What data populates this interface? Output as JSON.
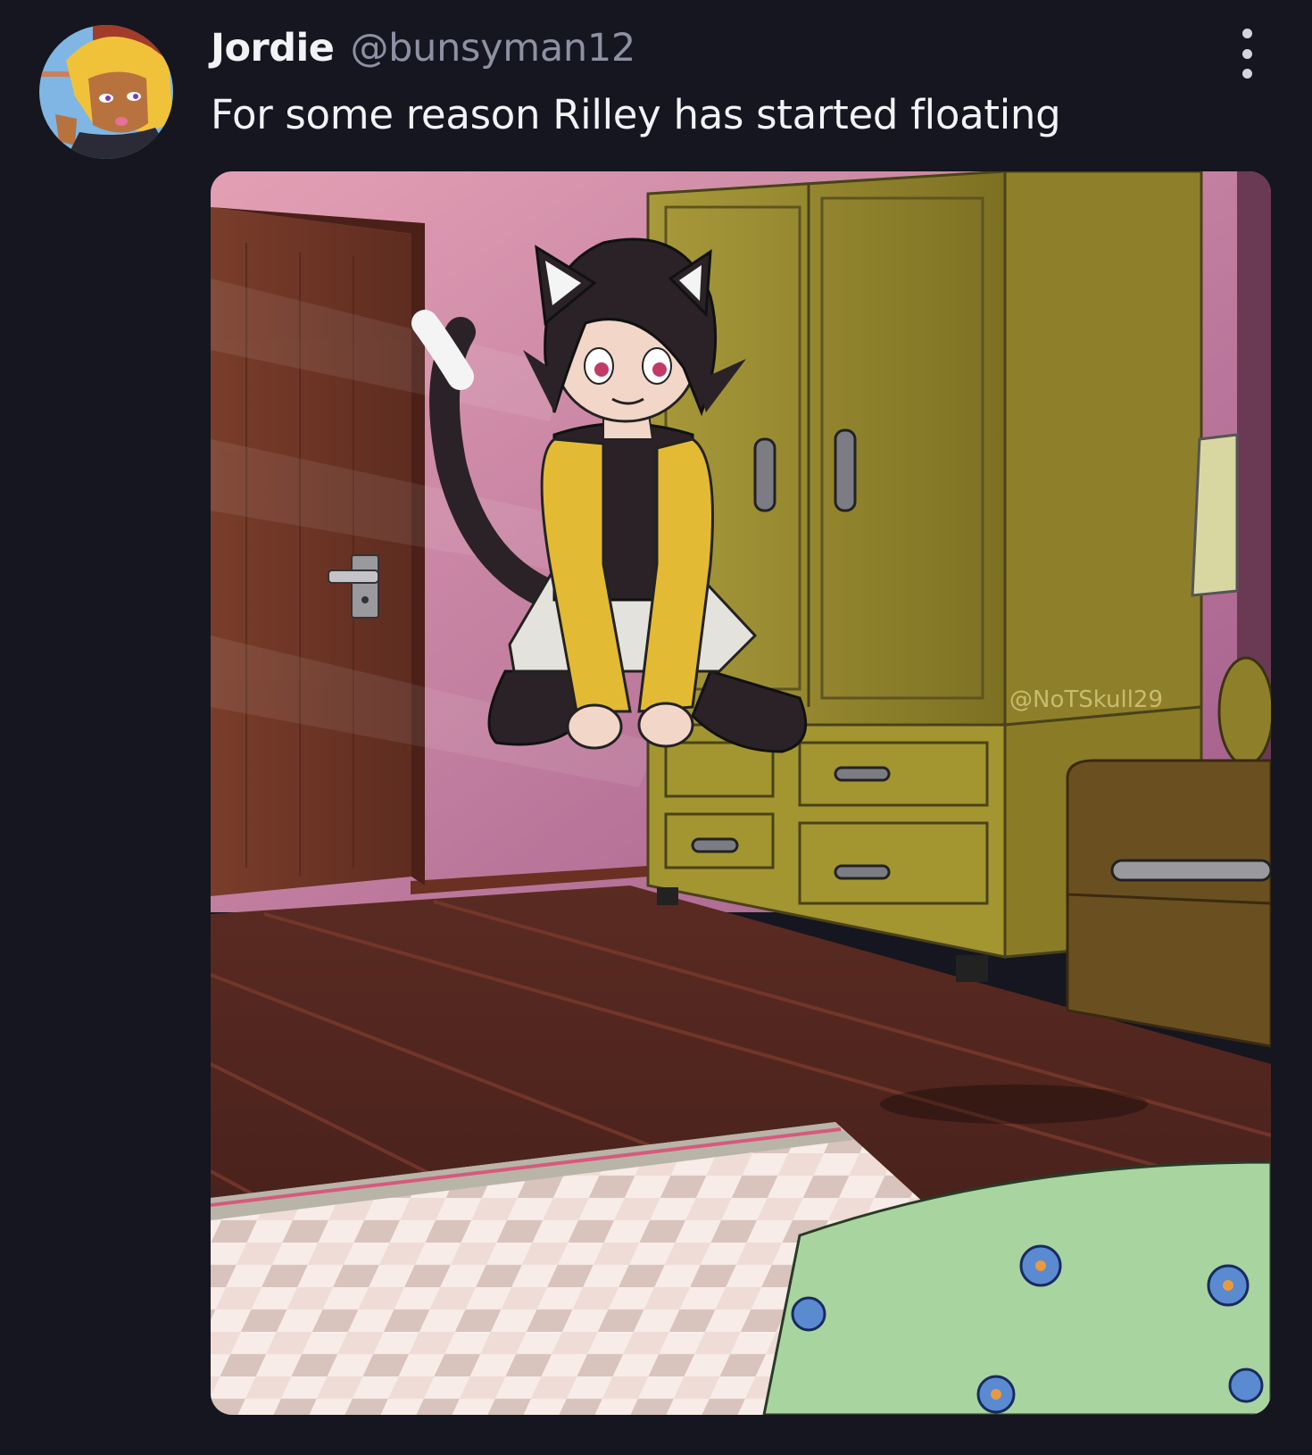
{
  "post": {
    "author": {
      "display_name": "Jordie",
      "handle": "@bunsyman12"
    },
    "text": "For some reason Rilley has started floating",
    "media": {
      "watermark": "@NoTSkull29"
    },
    "actions": {
      "more_icon": "vertical-ellipsis-icon"
    }
  },
  "colors": {
    "background": "#15161f",
    "text_primary": "#f2f3f7",
    "text_secondary": "#8e90a3"
  }
}
